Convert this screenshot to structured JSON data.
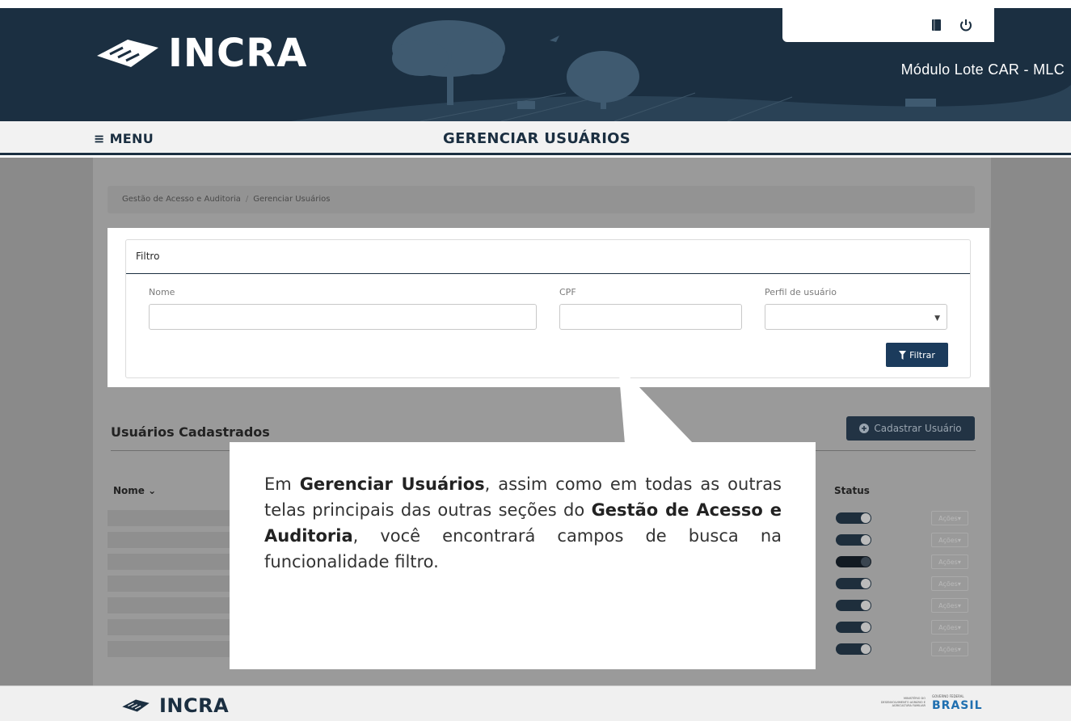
{
  "header": {
    "brand": "INCRA",
    "module_title": "Módulo Lote CAR - MLC",
    "icons": [
      "book-icon",
      "power-icon"
    ]
  },
  "nav": {
    "menu_label": "≡ MENU",
    "page_title": "GERENCIAR USUÁRIOS"
  },
  "breadcrumb": {
    "items": [
      "Gestão de Acesso e Auditoria",
      "Gerenciar Usuários"
    ],
    "separator": "/"
  },
  "filter": {
    "title": "Filtro",
    "fields": {
      "nome_label": "Nome",
      "nome_value": "",
      "cpf_label": "CPF",
      "cpf_value": "",
      "perfil_label": "Perfil de usuário",
      "perfil_value": ""
    },
    "submit_label": "Filtrar",
    "submit_icon": "funnel-icon"
  },
  "users": {
    "section_title": "Usuários Cadastrados",
    "add_button_label": "Cadastrar Usuário",
    "add_button_icon": "plus-circle-icon",
    "columns": {
      "nome": "Nome",
      "status": "Status"
    },
    "row_action_label": "Ações",
    "rows": [
      {
        "status": "on"
      },
      {
        "status": "on"
      },
      {
        "status": "off"
      },
      {
        "status": "on"
      },
      {
        "status": "on"
      },
      {
        "status": "on"
      },
      {
        "status": "on"
      }
    ]
  },
  "callout": {
    "parts": [
      {
        "text": "Em ",
        "bold": false
      },
      {
        "text": "Gerenciar Usuários",
        "bold": true
      },
      {
        "text": ", assim como em todas as outras telas principais das outras seções do ",
        "bold": false
      },
      {
        "text": "Gestão de Acesso e Auditoria",
        "bold": true
      },
      {
        "text": ", você encontrará campos de busca na funcionalidade filtro.",
        "bold": false
      }
    ]
  },
  "footer": {
    "brand": "INCRA",
    "gov_mark": "BRASIL",
    "gov_text_1": "GOVERNO FEDERAL",
    "gov_text_2": "MINISTÉRIO DO DESENVOLVIMENTO AGRÁRIO E AGRICULTURA FAMILIAR"
  },
  "colors": {
    "brand_dark": "#1b2f41",
    "button_primary": "#1b3b5c",
    "overlay_gray": "#9a9a9a"
  }
}
